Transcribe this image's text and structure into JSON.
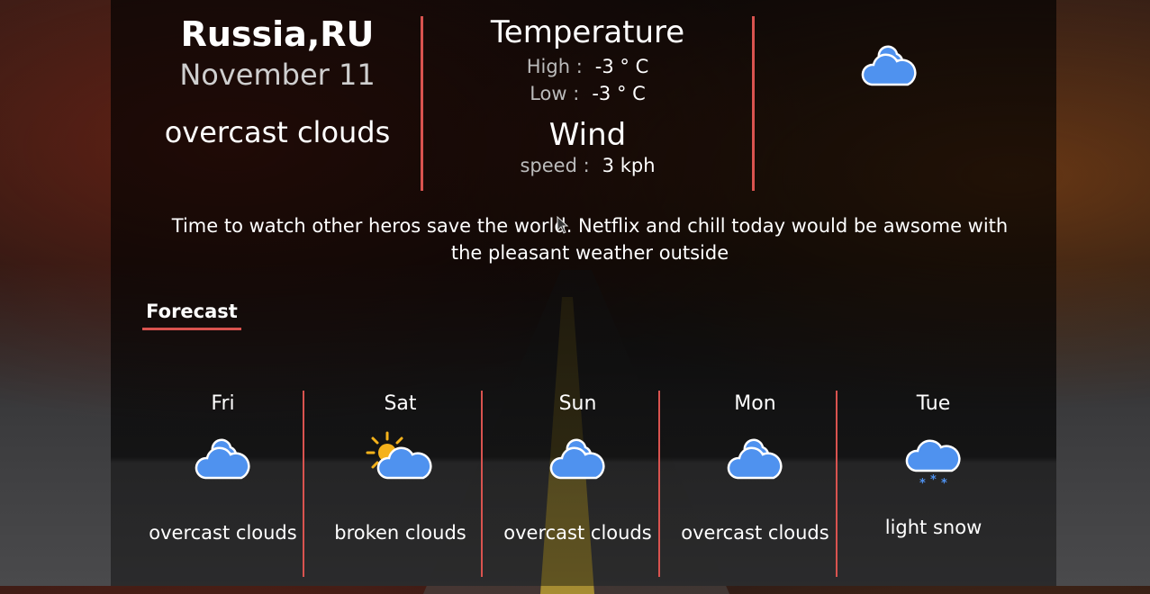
{
  "current": {
    "location": "Russia,RU",
    "date": "November 11",
    "description": "overcast clouds",
    "icon": "overcast-cloud-icon"
  },
  "temperature": {
    "heading": "Temperature",
    "high_label": "High :",
    "high_value": "-3 ° C",
    "low_label": "Low :",
    "low_value": "-3 ° C"
  },
  "wind": {
    "heading": "Wind",
    "speed_label": "speed :",
    "speed_value": "3 kph"
  },
  "message": "Time to watch other heros save the world. Netflix and chill today would be awsome with the pleasant weather outside",
  "forecast": {
    "title": "Forecast",
    "days": [
      {
        "day": "Fri",
        "description": "overcast clouds",
        "icon": "overcast-cloud-icon"
      },
      {
        "day": "Sat",
        "description": "broken clouds",
        "icon": "sun-cloud-icon"
      },
      {
        "day": "Sun",
        "description": "overcast clouds",
        "icon": "overcast-cloud-icon"
      },
      {
        "day": "Mon",
        "description": "overcast clouds",
        "icon": "overcast-cloud-icon"
      },
      {
        "day": "Tue",
        "description": "light snow",
        "icon": "snow-cloud-icon"
      }
    ]
  },
  "colors": {
    "accent": "#d9534f",
    "cloud": "#4f92ef",
    "sun": "#f5b21b"
  }
}
